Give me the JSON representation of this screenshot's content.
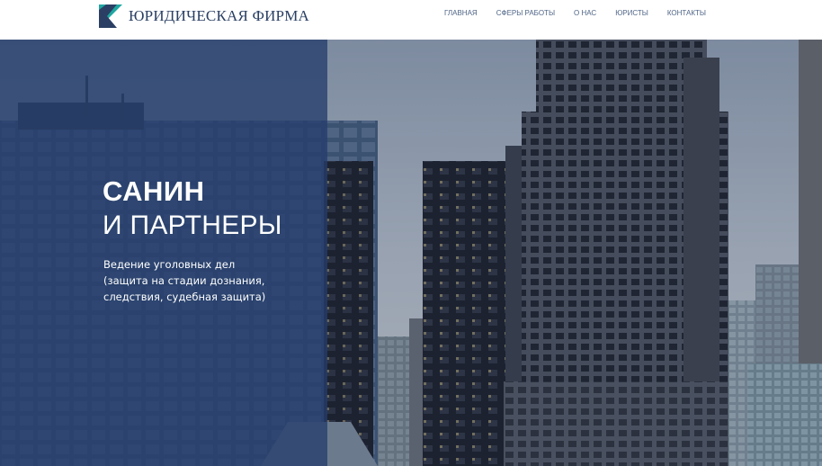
{
  "header": {
    "logo_text": "ЮРИДИЧЕСКАЯ ФИРМА",
    "nav": [
      {
        "label": "ГЛАВНАЯ"
      },
      {
        "label": "СФЕРЫ РАБОТЫ"
      },
      {
        "label": "О НАС"
      },
      {
        "label": "ЮРИСТЫ"
      },
      {
        "label": "КОНТАКТЫ"
      }
    ]
  },
  "hero": {
    "title_line1": "САНИН",
    "title_line2": "И ПАРТНЕРЫ",
    "description_lines": [
      "Ведение уголовных дел",
      "(защита на стадии дознания,",
      "следствия, судебная защита)"
    ],
    "background_image": "city skyscrapers"
  },
  "colors": {
    "brand": "#2a3f63",
    "logo_teal": "#1fa6a0",
    "overlay": "#253d6c",
    "nav_text": "#4f6587"
  }
}
